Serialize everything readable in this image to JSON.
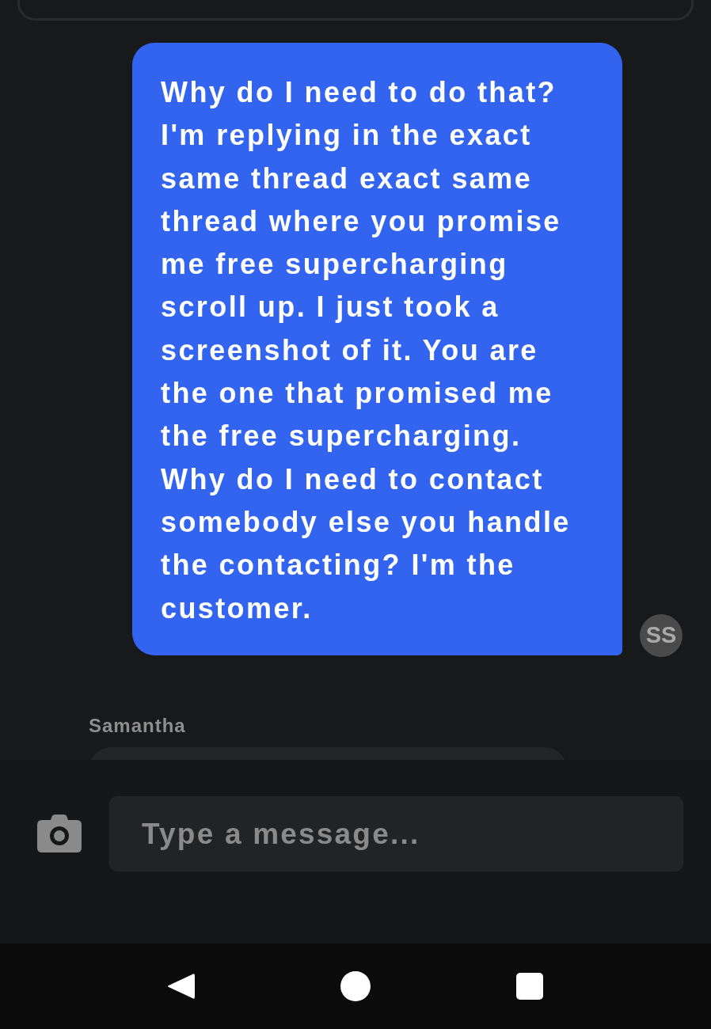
{
  "messages": [
    {
      "kind": "outgoing",
      "text": "Why do I need to do that? I'm replying in the exact same thread exact same thread where you promise me free supercharging scroll up. I just took a screenshot of it. You are the one that promised me the free supercharging. Why do I need to contact somebody else you handle the contacting? I'm the customer.",
      "avatar": "SS"
    },
    {
      "kind": "incoming",
      "sender": "Samantha"
    }
  ],
  "composer": {
    "placeholder": "Type a message..."
  }
}
